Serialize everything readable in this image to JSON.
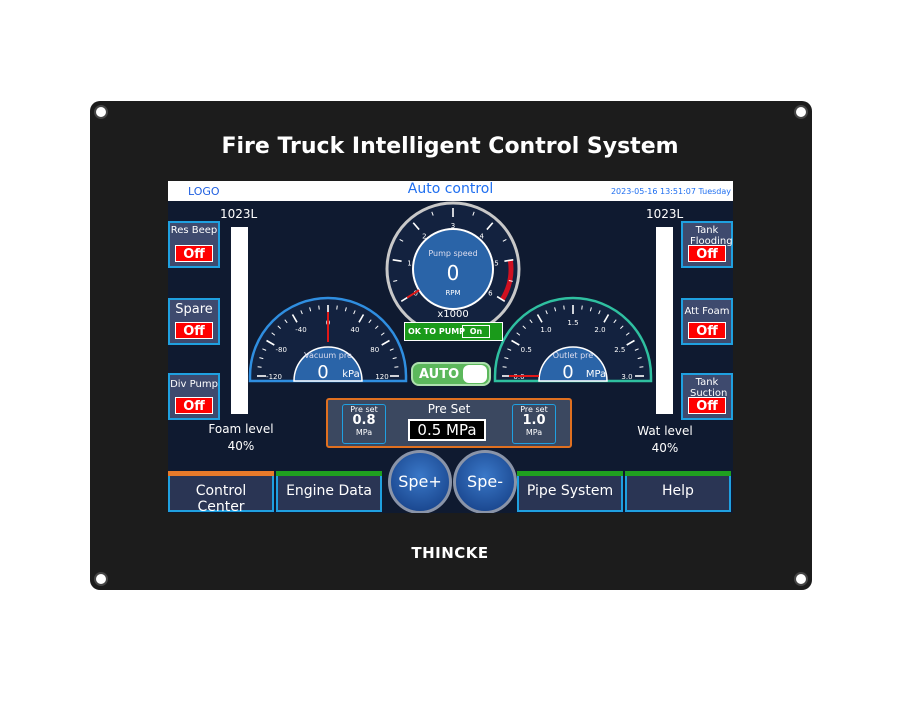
{
  "device": {
    "title": "Fire Truck Intelligent Control System",
    "brand": "THINCKE"
  },
  "header": {
    "logo": "LOGO",
    "title": "Auto control",
    "datetime": "2023-05-16 13:51:07 Tuesday"
  },
  "left_switches": [
    {
      "label": "Res Beep",
      "state": "Off"
    },
    {
      "label": "Spare",
      "state": "Off"
    },
    {
      "label": "Div Pump",
      "state": "Off"
    }
  ],
  "right_switches": [
    {
      "label": "Tank Flooding",
      "state": "Off"
    },
    {
      "label": "Att Foam",
      "state": "Off"
    },
    {
      "label": "Tank Suction",
      "state": "Off"
    }
  ],
  "foam": {
    "capacity": "1023L",
    "label": "Foam level",
    "value": "40%"
  },
  "water": {
    "capacity": "1023L",
    "label": "Wat level",
    "value": "40%"
  },
  "pump_gauge": {
    "label": "Pump speed",
    "value": "0",
    "unit": "RPM",
    "multiplier": "x1000",
    "ticks": [
      "0",
      "1",
      "2",
      "3",
      "4",
      "5",
      "6"
    ],
    "min": 0,
    "max": 6,
    "reading": 0
  },
  "vacuum_gauge": {
    "label": "Vacuum pre",
    "value": "0",
    "unit": "kPa",
    "ticks": [
      "-120",
      "-80",
      "-40",
      "0",
      "40",
      "80",
      "120"
    ],
    "min": -120,
    "max": 120,
    "reading": 0
  },
  "outlet_gauge": {
    "label": "Outlet pre",
    "value": "0",
    "unit": "MPa",
    "ticks": [
      "0.0",
      "0.5",
      "1.0",
      "1.5",
      "2.0",
      "2.5",
      "3.0"
    ],
    "min": 0,
    "max": 3,
    "reading": 0
  },
  "ok_to_pump": {
    "label": "OK TO PUMP",
    "state": "On"
  },
  "mode_toggle": {
    "label": "AUTO"
  },
  "preset": {
    "title": "Pre Set",
    "current": "0.5 MPa",
    "left": {
      "label": "Pre set",
      "value": "0.8",
      "unit": "MPa"
    },
    "right": {
      "label": "Pre set",
      "value": "1.0",
      "unit": "MPa"
    }
  },
  "nav": [
    {
      "label": "Control Center",
      "accent": "#e87a2a"
    },
    {
      "label": "Engine Data",
      "accent": "#1fa01f"
    },
    {
      "label": "Pipe System",
      "accent": "#1fa01f"
    },
    {
      "label": "Help",
      "accent": "#1fa01f"
    }
  ],
  "speed_buttons": {
    "plus": "Spe+",
    "minus": "Spe-"
  }
}
